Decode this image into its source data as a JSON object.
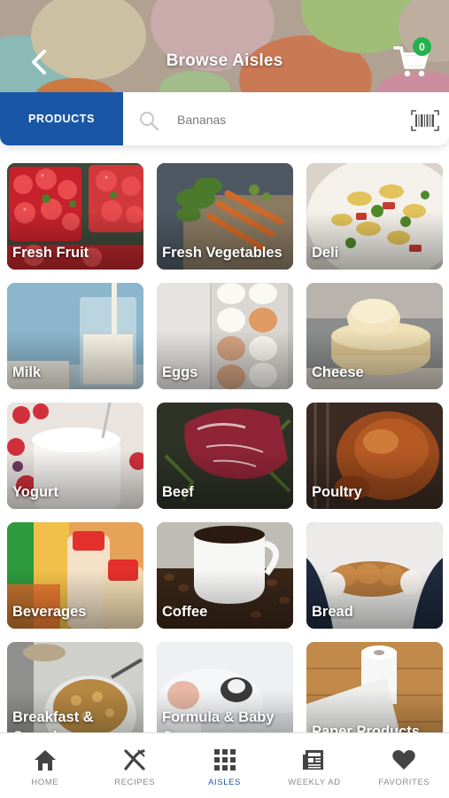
{
  "header": {
    "title": "Browse Aisles",
    "back_icon": "chevron-left-icon",
    "cart_icon": "shopping-cart-icon",
    "cart_count": "0",
    "badge_color": "#23b14d"
  },
  "search": {
    "mode_label": "PRODUCTS",
    "placeholder": "Bananas",
    "value": "",
    "search_icon": "magnifier-icon",
    "barcode_icon": "barcode-icon",
    "accent_color": "#1a56a6"
  },
  "aisles": [
    {
      "label": "Fresh Fruit"
    },
    {
      "label": "Fresh Vegetables"
    },
    {
      "label": "Deli"
    },
    {
      "label": "Milk"
    },
    {
      "label": "Eggs"
    },
    {
      "label": "Cheese"
    },
    {
      "label": "Yogurt"
    },
    {
      "label": "Beef"
    },
    {
      "label": "Poultry"
    },
    {
      "label": "Beverages"
    },
    {
      "label": "Coffee"
    },
    {
      "label": "Bread"
    },
    {
      "label": "Breakfast & Cereal"
    },
    {
      "label": "Formula & Baby Care"
    },
    {
      "label": "Paper Products"
    }
  ],
  "nav": {
    "active": "AISLES",
    "items": [
      {
        "label": "HOME",
        "icon": "home-icon"
      },
      {
        "label": "RECIPES",
        "icon": "fork-knife-icon"
      },
      {
        "label": "AISLES",
        "icon": "grid-icon"
      },
      {
        "label": "WEEKLY AD",
        "icon": "newspaper-icon"
      },
      {
        "label": "FAVORITES",
        "icon": "heart-icon"
      }
    ]
  }
}
